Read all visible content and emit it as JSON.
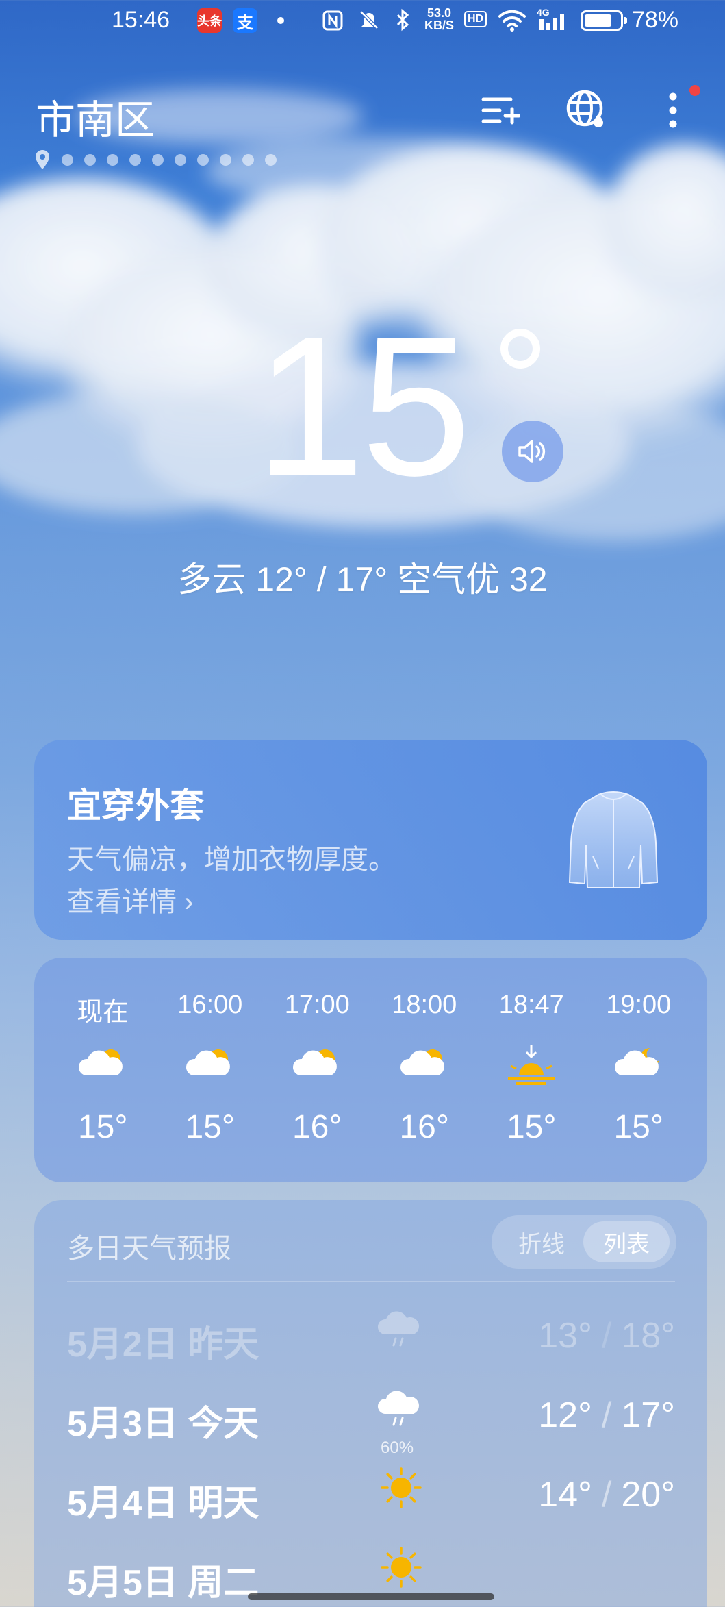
{
  "status_bar": {
    "time": "15:46",
    "app_badge_1": "头条",
    "app_badge_2": "支",
    "net_speed_value": "53.0",
    "net_speed_unit": "KB/S",
    "hd": "HD",
    "network": "4G",
    "battery_level": 0.78,
    "battery_text": "78%"
  },
  "header": {
    "city": "市南区",
    "city_page_count": 10,
    "menu_icons": [
      "add-city-icon",
      "globe-icon",
      "more-icon"
    ],
    "has_notification": true
  },
  "current": {
    "temperature": "15",
    "summary": "多云  12° / 17°  空气优 32"
  },
  "outfit": {
    "title": "宜穿外套",
    "description": "天气偏凉，增加衣物厚度。",
    "link": "查看详情 ›"
  },
  "hourly": [
    {
      "time": "现在",
      "icon": "partly-cloudy-icon",
      "temp": "15°"
    },
    {
      "time": "16:00",
      "icon": "partly-cloudy-icon",
      "temp": "15°"
    },
    {
      "time": "17:00",
      "icon": "partly-cloudy-icon",
      "temp": "16°"
    },
    {
      "time": "18:00",
      "icon": "partly-cloudy-icon",
      "temp": "16°"
    },
    {
      "time": "18:47",
      "icon": "sunset-icon",
      "temp": "15°"
    },
    {
      "time": "19:00",
      "icon": "partly-cloudy-night-icon",
      "temp": "15°"
    }
  ],
  "daily": {
    "title": "多日天气预报",
    "toggle_line": "折线",
    "toggle_list": "列表",
    "selected": "列表",
    "days": [
      {
        "date": "5月2日  昨天",
        "icon": "rain-cloud-icon",
        "low": "13°",
        "high": "18°",
        "pop": ""
      },
      {
        "date": "5月3日  今天",
        "icon": "rain-cloud-icon",
        "low": "12°",
        "high": "17°",
        "pop": "60%"
      },
      {
        "date": "5月4日  明天",
        "icon": "sun-icon",
        "low": "14°",
        "high": "20°",
        "pop": ""
      },
      {
        "date": "5月5日  周二",
        "icon": "sun-icon",
        "low": "",
        "high": "",
        "pop": ""
      }
    ]
  },
  "colors": {
    "sky_top": "#2f68c7",
    "sun": "#f7b500",
    "notification": "#f04444"
  }
}
